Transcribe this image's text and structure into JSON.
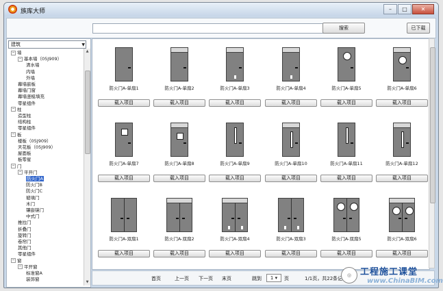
{
  "window": {
    "title": "族库大师",
    "controls": [
      "–",
      "□",
      "✕"
    ]
  },
  "toolbar": {
    "search_placeholder": "",
    "search_label": "搜索",
    "downloaded_label": "已下载"
  },
  "category": {
    "selected": "建筑"
  },
  "tree": [
    {
      "label": "墙",
      "level": 0,
      "toggle": "⊟"
    },
    {
      "label": "基本墙（05J909）",
      "level": 1,
      "toggle": "⊟"
    },
    {
      "label": "清水墙",
      "level": 2
    },
    {
      "label": "内墙",
      "level": 2
    },
    {
      "label": "外墙",
      "level": 2
    },
    {
      "label": "幕墙嵌板",
      "level": 1
    },
    {
      "label": "幕墙门窗",
      "level": 1
    },
    {
      "label": "幕墙竖梃填充",
      "level": 1
    },
    {
      "label": "零星组件",
      "level": 1
    },
    {
      "label": "柱",
      "level": 0,
      "toggle": "⊟"
    },
    {
      "label": "造型柱",
      "level": 1
    },
    {
      "label": "结构柱",
      "level": 1
    },
    {
      "label": "零星组件",
      "level": 1
    },
    {
      "label": "板",
      "level": 0,
      "toggle": "⊟"
    },
    {
      "label": "楼板（05J909）",
      "level": 1
    },
    {
      "label": "天花板（05J909）",
      "level": 1
    },
    {
      "label": "屋面板",
      "level": 1
    },
    {
      "label": "板零星",
      "level": 1
    },
    {
      "label": "门",
      "level": 0,
      "toggle": "⊟"
    },
    {
      "label": "平开门",
      "level": 1,
      "toggle": "⊟"
    },
    {
      "label": "防火门A",
      "level": 2,
      "selected": true
    },
    {
      "label": "防火门B",
      "level": 2
    },
    {
      "label": "防火门C",
      "level": 2
    },
    {
      "label": "玻璃门",
      "level": 2
    },
    {
      "label": "木门",
      "level": 2
    },
    {
      "label": "镶嵌镜门",
      "level": 2
    },
    {
      "label": "中式门",
      "level": 2
    },
    {
      "label": "推拉门",
      "level": 1
    },
    {
      "label": "折叠门",
      "level": 1
    },
    {
      "label": "旋转门",
      "level": 1
    },
    {
      "label": "卷帘门",
      "level": 1
    },
    {
      "label": "其他门",
      "level": 1
    },
    {
      "label": "零星组件",
      "level": 1
    },
    {
      "label": "窗",
      "level": 0,
      "toggle": "⊟"
    },
    {
      "label": "平开窗",
      "level": 1,
      "toggle": "⊟"
    },
    {
      "label": "标准窗A",
      "level": 2
    },
    {
      "label": "装饰窗",
      "level": 2
    }
  ],
  "items": [
    {
      "name": "防火门A-单扇1",
      "door": "single",
      "transom": false,
      "feature": "handle"
    },
    {
      "name": "防火门A-单扇2",
      "door": "single",
      "transom": true,
      "feature": "handle"
    },
    {
      "name": "防火门A-单扇3",
      "door": "single",
      "transom": true,
      "feature": "lock"
    },
    {
      "name": "防火门A-单扇4",
      "door": "single",
      "transom": true,
      "feature": "lock"
    },
    {
      "name": "防火门A-单扇5",
      "door": "single",
      "transom": false,
      "feature": "round"
    },
    {
      "name": "防火门A-单扇6",
      "door": "single",
      "transom": true,
      "feature": "round"
    },
    {
      "name": "防火门A-单扇7",
      "door": "single",
      "transom": false,
      "feature": "square"
    },
    {
      "name": "防火门A-单扇8",
      "door": "single",
      "transom": true,
      "feature": "square"
    },
    {
      "name": "防火门A-单扇9",
      "door": "single",
      "transom": false,
      "feature": "vertical"
    },
    {
      "name": "防火门A-单扇10",
      "door": "single",
      "transom": true,
      "feature": "vertical"
    },
    {
      "name": "防火门A-单扇11",
      "door": "single",
      "transom": false,
      "feature": "vertical"
    },
    {
      "name": "防火门A-单扇12",
      "door": "single",
      "transom": true,
      "feature": "vertical"
    },
    {
      "name": "防火门A-双扇1",
      "door": "double",
      "transom": false,
      "feature": "handle"
    },
    {
      "name": "防火门A-双扇2",
      "door": "double",
      "transom": true,
      "feature": "handle"
    },
    {
      "name": "防火门A-双扇4",
      "door": "double",
      "transom": true,
      "feature": "lock"
    },
    {
      "name": "防火门A-双扇3",
      "door": "double",
      "transom": false,
      "feature": "lock"
    },
    {
      "name": "防火门A-双扇5",
      "door": "double",
      "transom": false,
      "feature": "round"
    },
    {
      "name": "防火门A-双扇6",
      "door": "double",
      "transom": true,
      "feature": "round"
    }
  ],
  "load_label": "载入项目",
  "pagination": {
    "first": "首页",
    "prev": "上一页",
    "next": "下一页",
    "last": "末页",
    "jump_label": "跳到",
    "page_value": "1",
    "page_unit": "页",
    "summary": "1/1页，共22条记录"
  },
  "watermark": {
    "text": "工程施工课堂",
    "sub": "www.ChinaBIM.com"
  }
}
